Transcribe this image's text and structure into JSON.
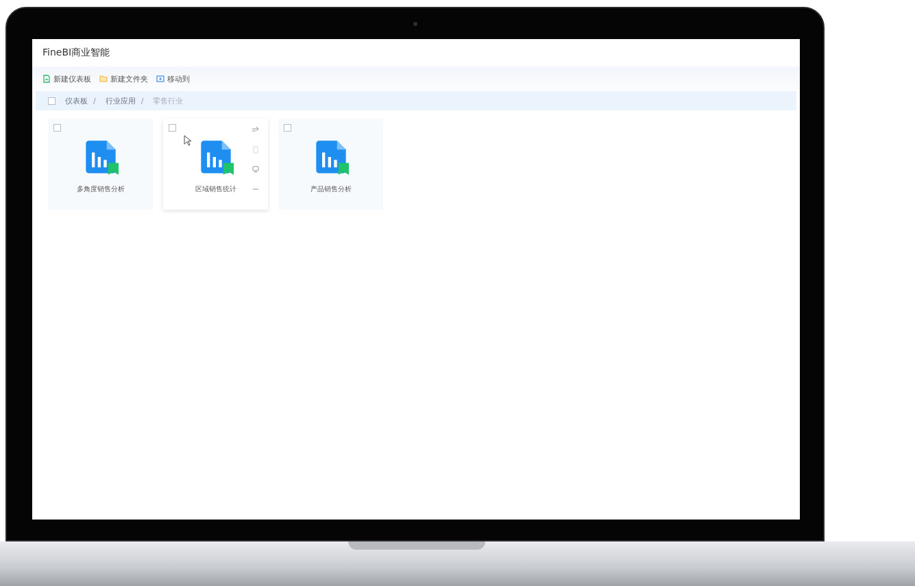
{
  "app": {
    "title": "FineBI商业智能"
  },
  "toolbar": [
    {
      "label": "新建仪表板",
      "kind": "dashboard"
    },
    {
      "label": "新建文件夹",
      "kind": "folder"
    },
    {
      "label": "移动到",
      "kind": "move"
    }
  ],
  "breadcrumb": {
    "checked": false,
    "separator": "/",
    "items": [
      {
        "label": "仪表板",
        "current": false
      },
      {
        "label": "行业应用",
        "current": false
      },
      {
        "label": "零售行业",
        "current": true
      }
    ]
  },
  "cards": [
    {
      "name": "多角度销售分析",
      "checked": false,
      "hovered": false
    },
    {
      "name": "区域销售统计",
      "checked": false,
      "hovered": true
    },
    {
      "name": "产品销售分析",
      "checked": false,
      "hovered": false
    }
  ]
}
